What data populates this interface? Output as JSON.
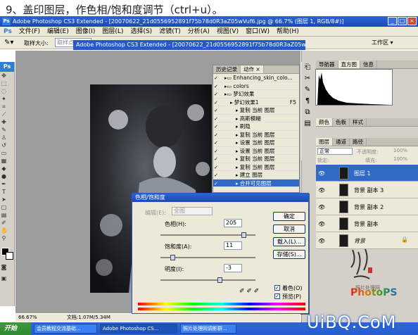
{
  "caption": "9、盖印图层，作色相/饱和度调节（ctrl+u）。",
  "app_title": "Adobe Photoshop CS3 Extended - [20070622_21d0556952891f75b78d0R3aZ05wVuf6.jpg @ 66.7% (图层 1, RGB/8#)]",
  "window_buttons": [
    "_",
    "□",
    "×"
  ],
  "menu": [
    "文件(F)",
    "编辑(E)",
    "图像(I)",
    "图层(L)",
    "选择(S)",
    "滤镜(T)",
    "分析(A)",
    "视图(V)",
    "窗口(W)",
    "帮助(H)"
  ],
  "options_bar": {
    "sample_label": "取样大小:",
    "sample_value": "取样点",
    "workspace": "工作区 ▾"
  },
  "status": {
    "zoom": "66.67%",
    "doc": "文档:1.07M/5.34M"
  },
  "taskbar": {
    "start": "开始",
    "tasks": [
      "会员教程交流基础...",
      "Adobe Photoshop CS...",
      "照片处理网调影群..."
    ]
  },
  "actions_panel": {
    "tabs": [
      "历史记录",
      "动作 ×"
    ],
    "rows": [
      {
        "label": "Enhancing_skin_colo...",
        "indent": 0,
        "kind": "folder"
      },
      {
        "label": "colors",
        "indent": 0,
        "kind": "folder"
      },
      {
        "label": "梦幻效果",
        "indent": 0,
        "kind": "folder"
      },
      {
        "label": "梦幻效果1",
        "key": "F5",
        "indent": 1,
        "kind": "action"
      },
      {
        "label": "复制 当前 图层",
        "indent": 2,
        "kind": "step"
      },
      {
        "label": "高斯模糊",
        "indent": 2,
        "kind": "step"
      },
      {
        "label": "刷隐",
        "indent": 2,
        "kind": "step"
      },
      {
        "label": "复制 当前 图层",
        "indent": 2,
        "kind": "step"
      },
      {
        "label": "设置 当前 图层",
        "indent": 2,
        "kind": "step"
      },
      {
        "label": "设置 当前 图层",
        "indent": 2,
        "kind": "step"
      },
      {
        "label": "复制 当前 图层",
        "indent": 2,
        "kind": "step"
      },
      {
        "label": "复制 当前 图层",
        "indent": 2,
        "kind": "step"
      },
      {
        "label": "建立 图层",
        "indent": 2,
        "kind": "step"
      },
      {
        "label": "合并可见图层",
        "indent": 2,
        "kind": "step",
        "selected": true
      }
    ]
  },
  "navigator_tabs": [
    "导航器",
    "直方图",
    "信息"
  ],
  "color_tabs": [
    "颜色",
    "色板",
    "样式"
  ],
  "layers_panel": {
    "tabs": [
      "图层",
      "通道",
      "路径"
    ],
    "blend_mode": "正常",
    "opacity_label": "不透明度:",
    "opacity": "100%",
    "lock_label": "锁定:",
    "fill_label": "填充:",
    "fill": "100%",
    "layers": [
      {
        "name": "图层 1",
        "selected": true
      },
      {
        "name": "背景 副本 3",
        "selected": false
      },
      {
        "name": "背景 副本 2",
        "selected": false
      },
      {
        "name": "背景 副本",
        "selected": false
      },
      {
        "name": "背景",
        "selected": false,
        "locked": true
      }
    ]
  },
  "hue_sat_dialog": {
    "title": "色相/饱和度",
    "edit_label": "编辑(E):",
    "edit_value": "全图",
    "hue_label": "色相(H):",
    "hue_value": "205",
    "hue_fraction": 0.85,
    "sat_label": "饱和度(A):",
    "sat_value": "11",
    "sat_fraction": 0.1,
    "light_label": "明度(I):",
    "light_value": "-3",
    "light_fraction": 0.6,
    "ok": "确定",
    "cancel": "取消",
    "load": "载入(L)...",
    "save": "存储(S)...",
    "colorize_label": "着色(O)",
    "colorize": true,
    "preview_label": "预览(P)",
    "preview": true
  },
  "watermark": {
    "site": "UiBQ.CoM",
    "photops": "PhotoPS",
    "sub": "照片处理网"
  }
}
